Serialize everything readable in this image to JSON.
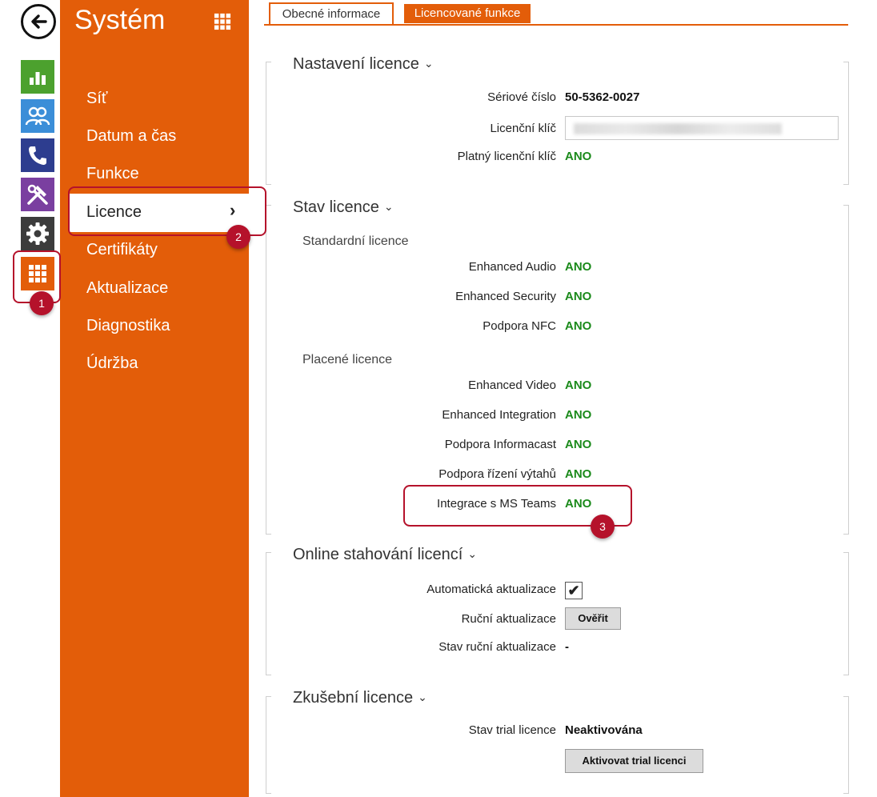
{
  "rail": {
    "items": [
      {
        "icon": "back-arrow-icon"
      },
      {
        "icon": "chart-icon",
        "color": "#4ca12e"
      },
      {
        "icon": "users-icon",
        "color": "#3b8ed8"
      },
      {
        "icon": "phone-icon",
        "color": "#2d3d8f"
      },
      {
        "icon": "tools-icon",
        "color": "#7a3fa0"
      },
      {
        "icon": "gear-icon",
        "color": "#3c3c3c"
      },
      {
        "icon": "grid-icon",
        "color": "#e35d09"
      }
    ]
  },
  "sidebar": {
    "title": "Systém",
    "items": [
      "Síť",
      "Datum a čas",
      "Funkce",
      "Licence",
      "Certifikáty",
      "Aktualizace",
      "Diagnostika",
      "Údržba"
    ],
    "active": "Licence",
    "active_chevron": "›",
    "accent": "#e35d09"
  },
  "tabs": [
    "Obecné informace",
    "Licencované funkce"
  ],
  "sections": {
    "nastaveni": {
      "title": "Nastavení licence",
      "serial_label": "Sériové číslo",
      "serial_value": "50-5362-0027",
      "key_label": "Licenční klíč",
      "valid_label": "Platný licenční klíč",
      "valid_value": "ANO"
    },
    "stav": {
      "title": "Stav licence",
      "standard_title": "Standardní licence",
      "standard": [
        {
          "label": "Enhanced Audio",
          "value": "ANO"
        },
        {
          "label": "Enhanced Security",
          "value": "ANO"
        },
        {
          "label": "Podpora NFC",
          "value": "ANO"
        }
      ],
      "paid_title": "Placené licence",
      "paid": [
        {
          "label": "Enhanced Video",
          "value": "ANO"
        },
        {
          "label": "Enhanced Integration",
          "value": "ANO"
        },
        {
          "label": "Podpora Informacast",
          "value": "ANO"
        },
        {
          "label": "Podpora řízení výtahů",
          "value": "ANO"
        },
        {
          "label": "Integrace s MS Teams",
          "value": "ANO"
        }
      ]
    },
    "online": {
      "title": "Online stahování licencí",
      "auto_label": "Automatická aktualizace",
      "auto_checked": true,
      "manual_label": "Ruční aktualizace",
      "verify_button": "Ověřit",
      "manual_status_label": "Stav ruční aktualizace",
      "manual_status_value": "-"
    },
    "trial": {
      "title": "Zkušební licence",
      "status_label": "Stav trial licence",
      "status_value": "Neaktivována",
      "activate_button": "Aktivovat trial licenci"
    }
  },
  "callouts": [
    "1",
    "2",
    "3"
  ],
  "colors": {
    "ok": "#1b8a1b",
    "callout": "#b5122b"
  }
}
